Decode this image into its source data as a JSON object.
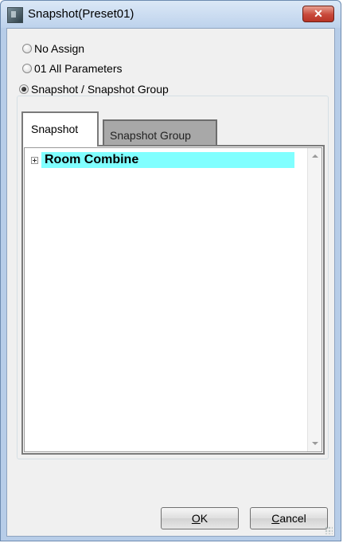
{
  "window": {
    "title": "Snapshot(Preset01)",
    "close_label": "✕"
  },
  "options": {
    "no_assign": "No Assign",
    "all_params": "01 All Parameters",
    "snapshot_group": "Snapshot / Snapshot Group",
    "selected": "snapshot_group"
  },
  "tabs": {
    "active": "Snapshot",
    "inactive": "Snapshot Group"
  },
  "tree": {
    "items": [
      {
        "label": "Room Combine",
        "expanded": false,
        "highlight": "#80ffff"
      }
    ]
  },
  "buttons": {
    "ok_mnemonic": "O",
    "ok_rest": "K",
    "cancel_mnemonic": "C",
    "cancel_rest": "ancel"
  }
}
